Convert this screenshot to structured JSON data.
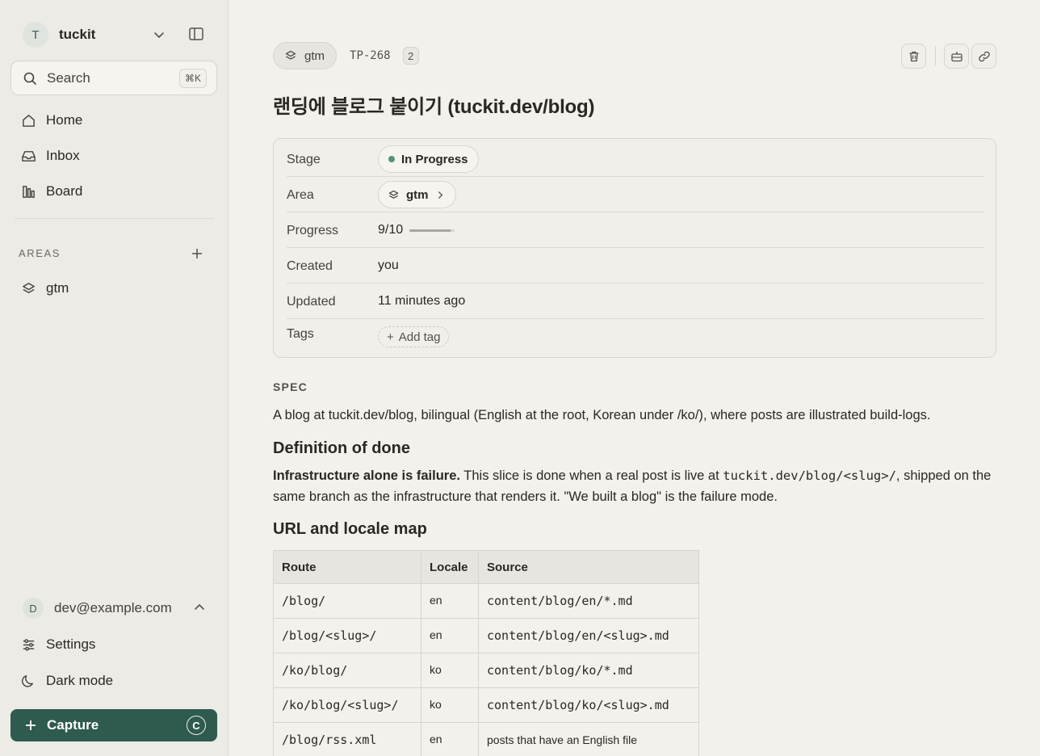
{
  "sidebar": {
    "workspace": {
      "initial": "T",
      "name": "tuckit"
    },
    "search": {
      "label": "Search",
      "shortcut": "⌘K"
    },
    "nav": [
      {
        "label": "Home",
        "icon": "home-icon"
      },
      {
        "label": "Inbox",
        "icon": "inbox-icon"
      },
      {
        "label": "Board",
        "icon": "board-icon"
      }
    ],
    "areas_label": "AREAS",
    "areas": [
      {
        "label": "gtm",
        "icon": "layers-icon"
      }
    ],
    "user": {
      "initial": "D",
      "email": "dev@example.com"
    },
    "settings_label": "Settings",
    "dark_mode_label": "Dark mode",
    "capture": {
      "label": "Capture",
      "key": "C"
    }
  },
  "header": {
    "area": "gtm",
    "task_id": "TP-268",
    "count": "2",
    "title": "랜딩에 블로그 붙이기 (tuckit.dev/blog)"
  },
  "properties": {
    "stage": {
      "key": "Stage",
      "value": "In Progress",
      "color": "#5a8f7d"
    },
    "area": {
      "key": "Area",
      "value": "gtm"
    },
    "progress": {
      "key": "Progress",
      "value": "9/10",
      "fraction": 0.9
    },
    "created": {
      "key": "Created",
      "value": "you"
    },
    "updated": {
      "key": "Updated",
      "value": "11 minutes ago"
    },
    "tags": {
      "key": "Tags",
      "add_label": "Add tag"
    }
  },
  "doc": {
    "section_label": "SPEC",
    "intro": "A blog at tuckit.dev/blog, bilingual (English at the root, Korean under /ko/), where posts are illustrated build-logs.",
    "h_done": "Definition of done",
    "done_bold": "Infrastructure alone is failure.",
    "done_text1": " This slice is done when a real post is live at ",
    "done_code": "tuckit.dev/blog/<slug>/",
    "done_text2": ", shipped on the same branch as the infrastructure that renders it. \"We built a blog\" is the failure mode.",
    "h_url": "URL and locale map",
    "table": {
      "headers": [
        "Route",
        "Locale",
        "Source"
      ],
      "rows": [
        [
          "/blog/",
          "en",
          "content/blog/en/*.md"
        ],
        [
          "/blog/<slug>/",
          "en",
          "content/blog/en/<slug>.md"
        ],
        [
          "/ko/blog/",
          "ko",
          "content/blog/ko/*.md"
        ],
        [
          "/ko/blog/<slug>/",
          "ko",
          "content/blog/ko/<slug>.md"
        ],
        [
          "/blog/rss.xml",
          "en",
          "posts that have an English file"
        ]
      ]
    }
  }
}
